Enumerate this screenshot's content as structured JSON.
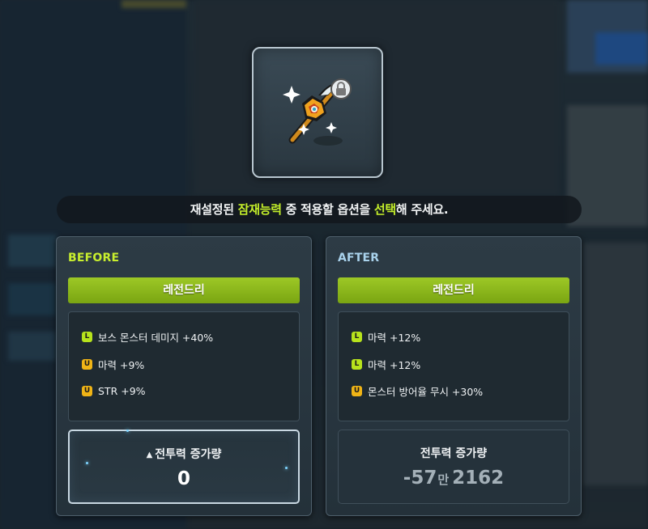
{
  "banner": {
    "part1": "재설정된 ",
    "highlight1": "잠재능력",
    "part2": " 중 적용할 옵션을 ",
    "highlight2": "선택",
    "part3": "해 주세요."
  },
  "item": {
    "icon": "staff-weapon-icon",
    "lock_icon": "lock-icon"
  },
  "before": {
    "title": "BEFORE",
    "grade": "레전드리",
    "options": [
      {
        "badge": "L",
        "text": "보스 몬스터 데미지 +40%"
      },
      {
        "badge": "U",
        "text": "마력 +9%"
      },
      {
        "badge": "U",
        "text": "STR +9%"
      }
    ],
    "power_label": "전투력 증가량",
    "power_indicator": "▲",
    "power_value": "0"
  },
  "after": {
    "title": "AFTER",
    "grade": "레전드리",
    "options": [
      {
        "badge": "L",
        "text": "마력 +12%"
      },
      {
        "badge": "L",
        "text": "마력 +12%"
      },
      {
        "badge": "U",
        "text": "몬스터 방어율 무시 +30%"
      }
    ],
    "power_label": "전투력 증가량",
    "power_value_main": "-57",
    "power_value_unit": "만",
    "power_value_rest": "2162"
  },
  "colors": {
    "legendary_green": "#9dc826",
    "highlight": "#c4ef2a",
    "unique_gold": "#f0b416",
    "after_title": "#a9d2ec"
  }
}
